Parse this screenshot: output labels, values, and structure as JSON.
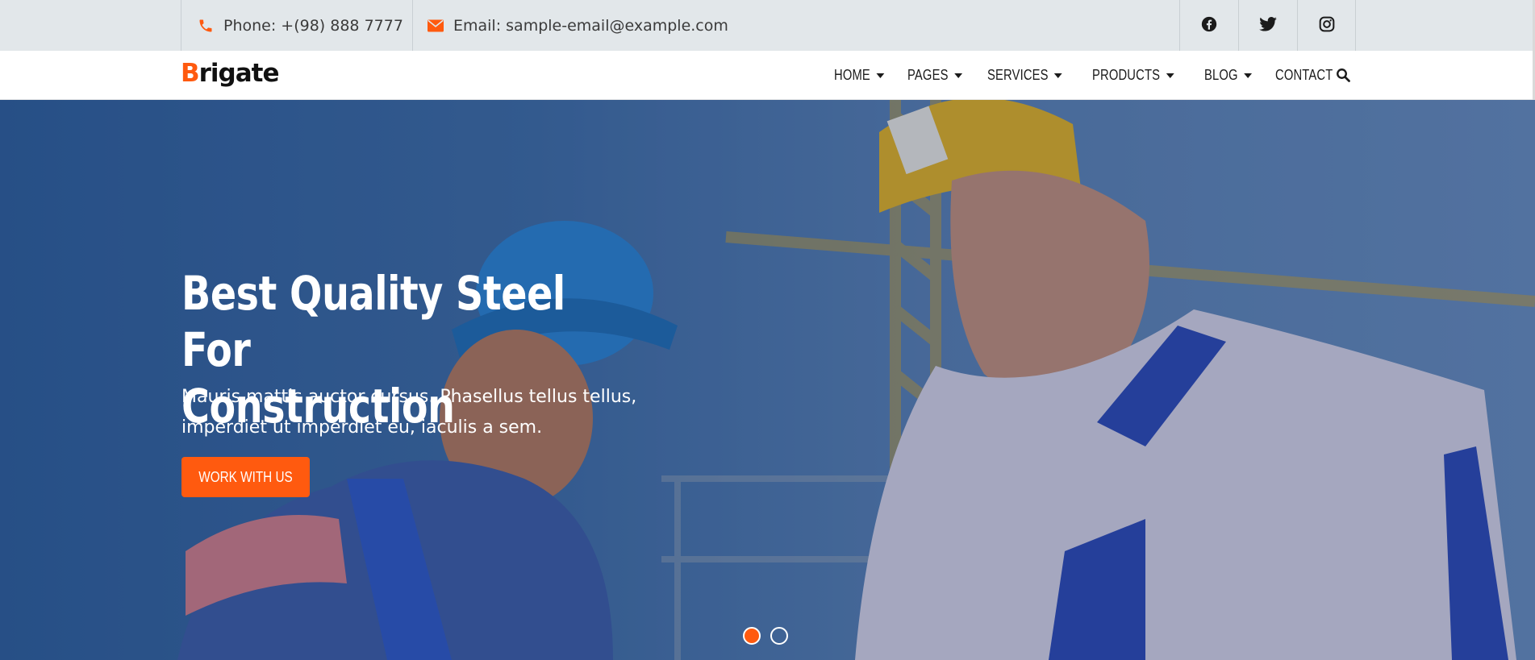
{
  "topbar": {
    "phone": "Phone: +(98) 888 7777",
    "email": "Email: sample-email@example.com",
    "social": [
      "facebook-icon",
      "twitter-icon",
      "instagram-icon"
    ]
  },
  "brand": {
    "first_letter": "B",
    "rest": "rigate",
    "accent": "#ff5a0f"
  },
  "nav": {
    "items": [
      {
        "label": "HOME",
        "dropdown": true
      },
      {
        "label": "PAGES",
        "dropdown": true
      },
      {
        "label": "SERVICES",
        "dropdown": true
      },
      {
        "label": "PRODUCTS",
        "dropdown": true
      },
      {
        "label": "BLOG",
        "dropdown": true
      },
      {
        "label": "CONTACT",
        "dropdown": false
      }
    ],
    "search_icon": "search-icon"
  },
  "hero": {
    "title_line1": "Best Quality Steel For",
    "title_line2": "Construction",
    "text_line1": "Mauris mattis auctor cursus. Phasellus tellus tellus,",
    "text_line2": "imperdiet ut imperdiet eu, iaculis a sem.",
    "cta": "WORK WITH US",
    "slides": 2,
    "active_slide": 1
  }
}
